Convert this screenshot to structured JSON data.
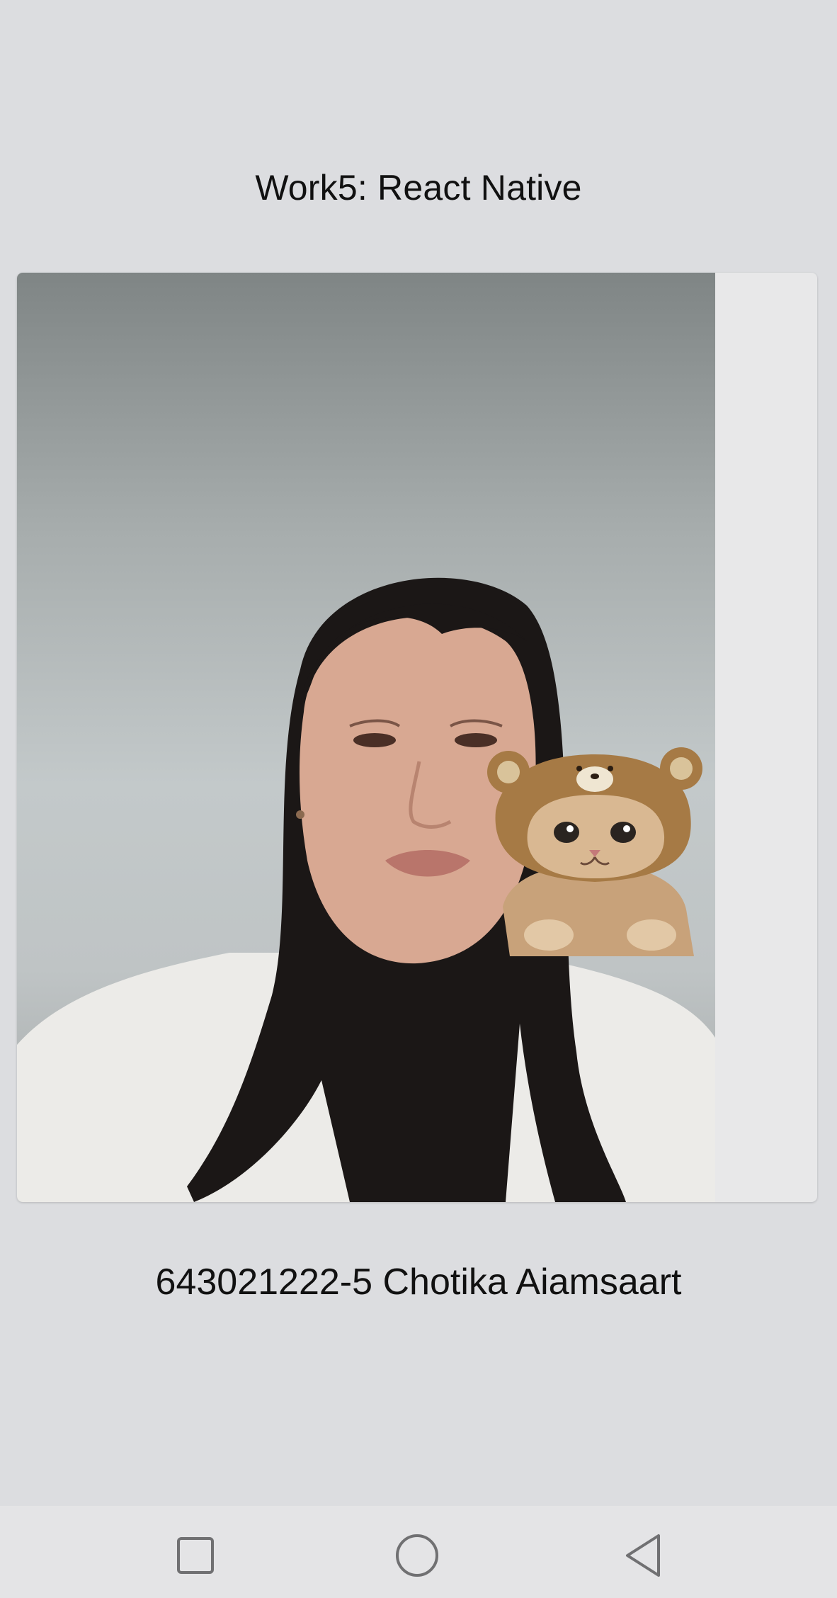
{
  "header": {
    "title": "Work5: React Native"
  },
  "camera": {
    "subject": "person-with-cat-sticker"
  },
  "footer": {
    "caption": "643021222-5 Chotika Aiamsaart"
  },
  "navbar": {
    "recent_icon": "square-icon",
    "home_icon": "circle-icon",
    "back_icon": "triangle-back-icon"
  },
  "colors": {
    "background": "#dcdde0",
    "card": "#e8e8e9",
    "text": "#111111",
    "navbar": "#e4e4e6"
  }
}
